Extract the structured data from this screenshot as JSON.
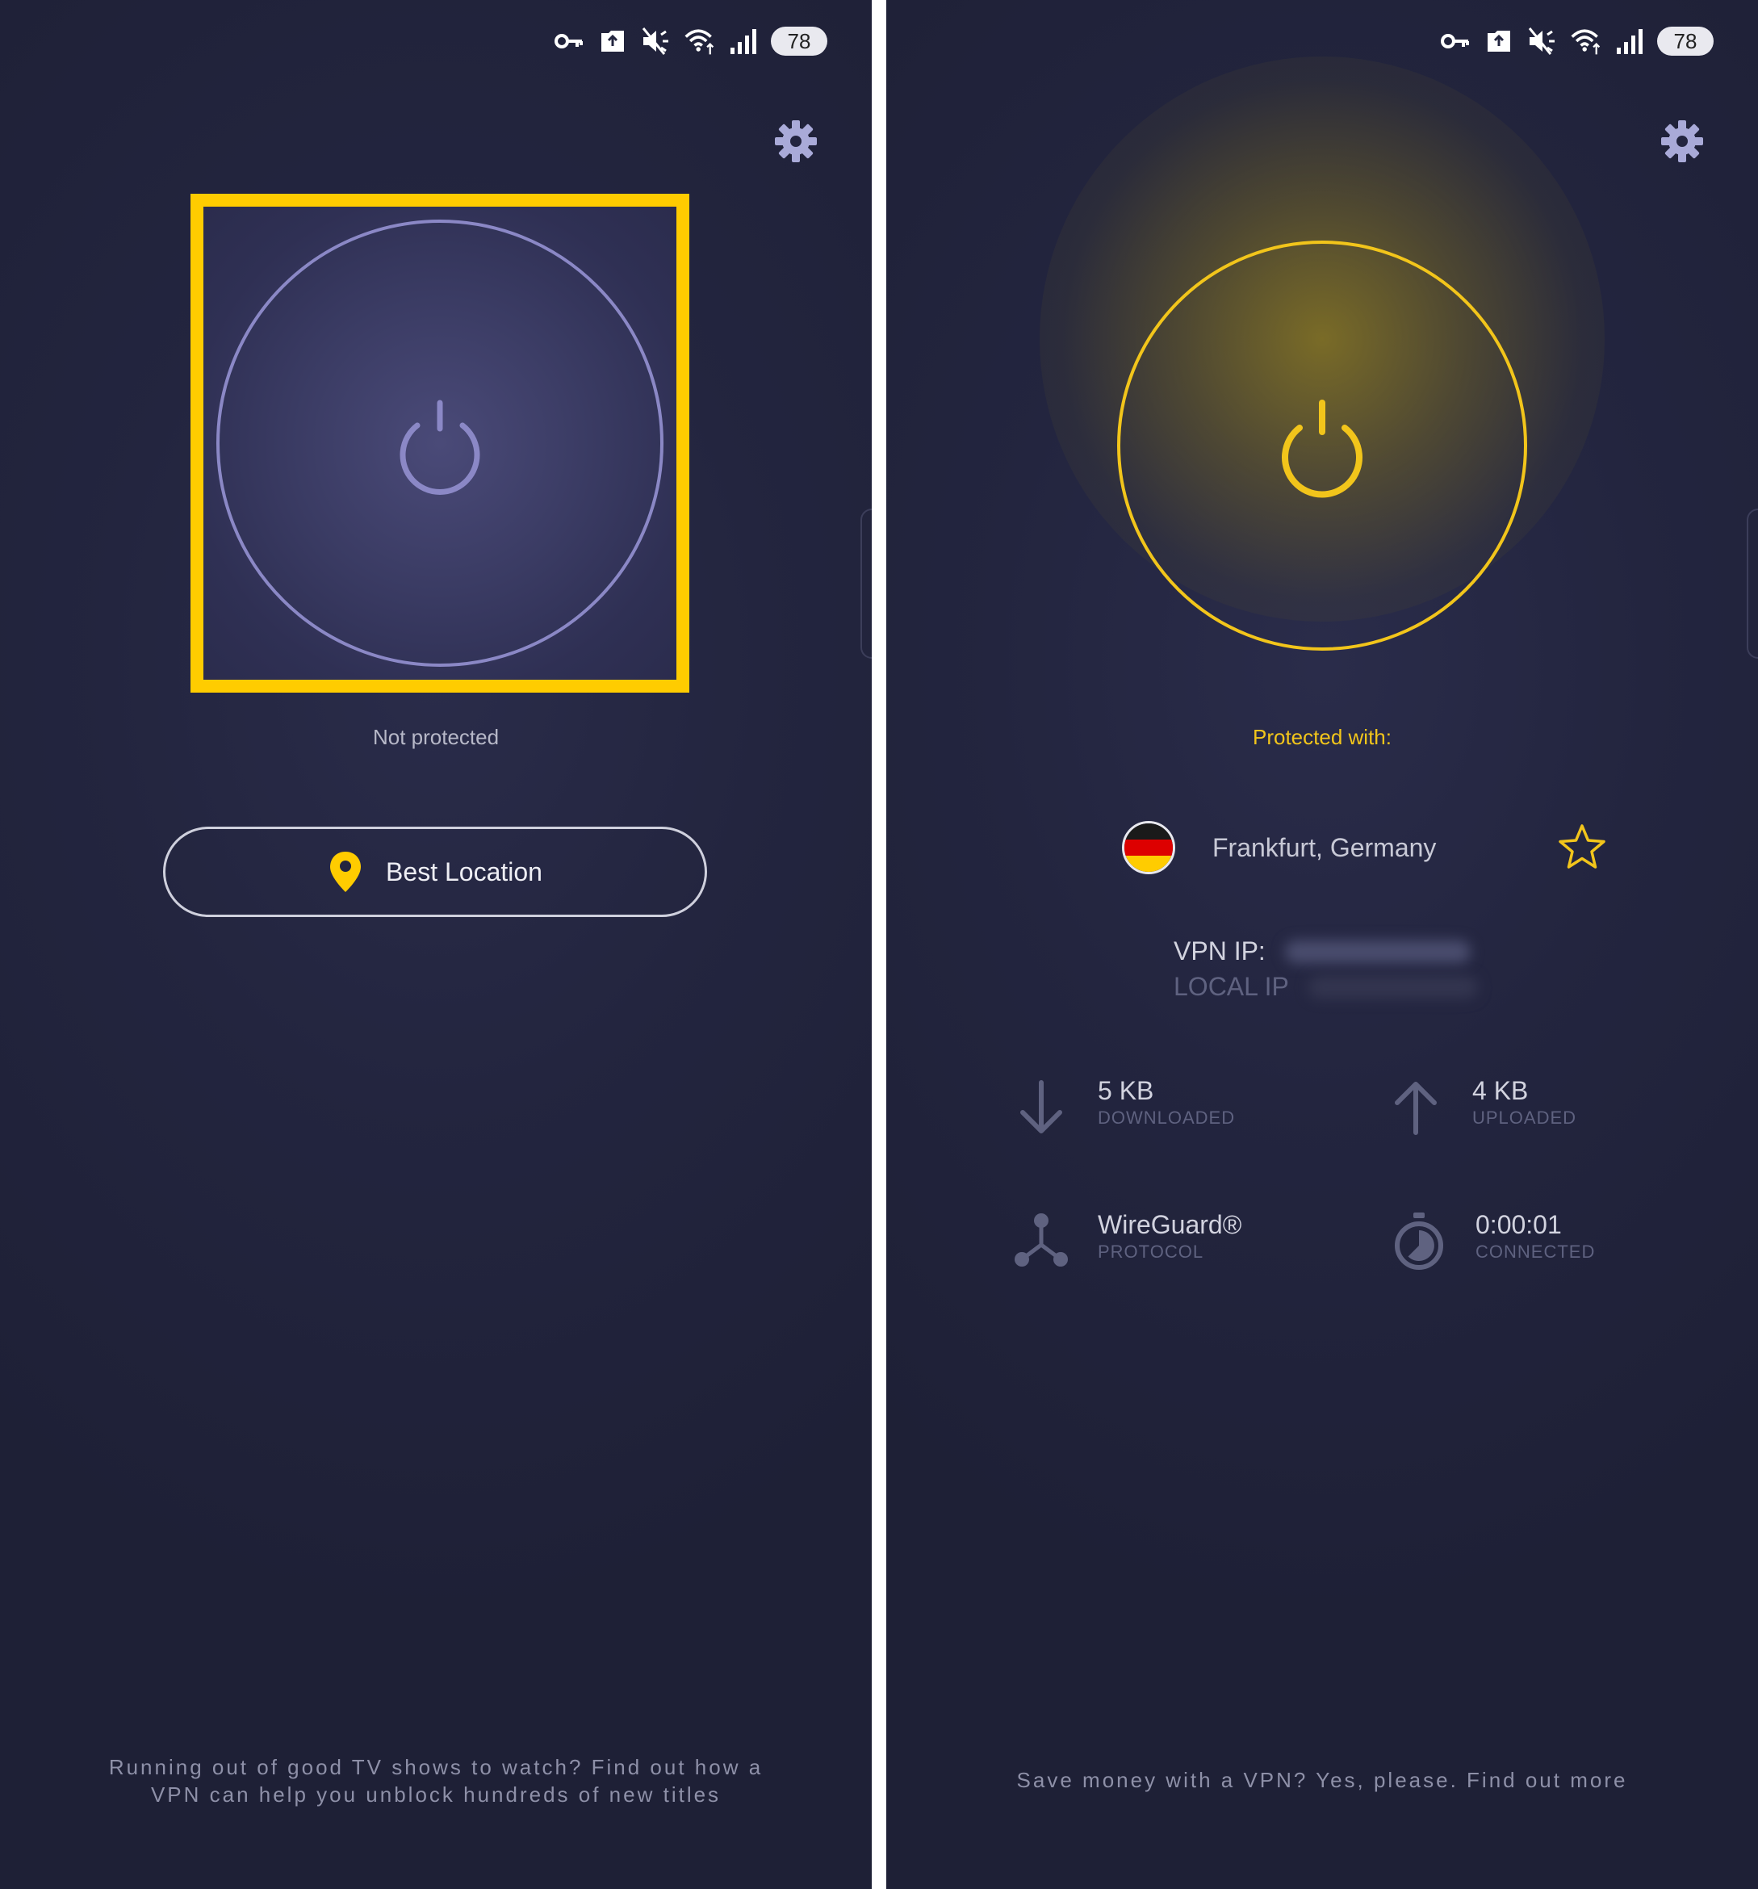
{
  "statusbar": {
    "battery": "78"
  },
  "left": {
    "status_text": "Not protected",
    "location_button": "Best Location",
    "footer": [
      "Running out of good TV shows to watch? Find out how a",
      "VPN can help you unblock hundreds of new titles"
    ]
  },
  "right": {
    "status_text": "Protected with:",
    "location": "Frankfurt, Germany",
    "vpn_ip_label": "VPN IP:",
    "local_ip_label": "LOCAL IP",
    "downloaded": {
      "value": "5 KB",
      "caption": "DOWNLOADED"
    },
    "uploaded": {
      "value": "4 KB",
      "caption": "UPLOADED"
    },
    "protocol": {
      "value": "WireGuard®",
      "caption": "PROTOCOL"
    },
    "connected": {
      "value": "0:00:01",
      "caption": "CONNECTED"
    },
    "footer": "Save money with a VPN? Yes, please. Find out more"
  },
  "colors": {
    "accent": "#ffcc00",
    "connected": "#f2c51b",
    "background": "#23253f",
    "ring_idle": "#8b88c6",
    "flag_black": "#1a1a1a",
    "flag_red": "#dd0000",
    "flag_gold": "#ffcc00"
  },
  "icons": [
    "vpn-key-icon",
    "notification-icon",
    "mute-icon",
    "wifi-icon",
    "signal-icon",
    "gear-icon",
    "power-icon",
    "location-pin-icon",
    "star-icon",
    "download-arrow-icon",
    "upload-arrow-icon",
    "protocol-icon",
    "timer-icon"
  ]
}
